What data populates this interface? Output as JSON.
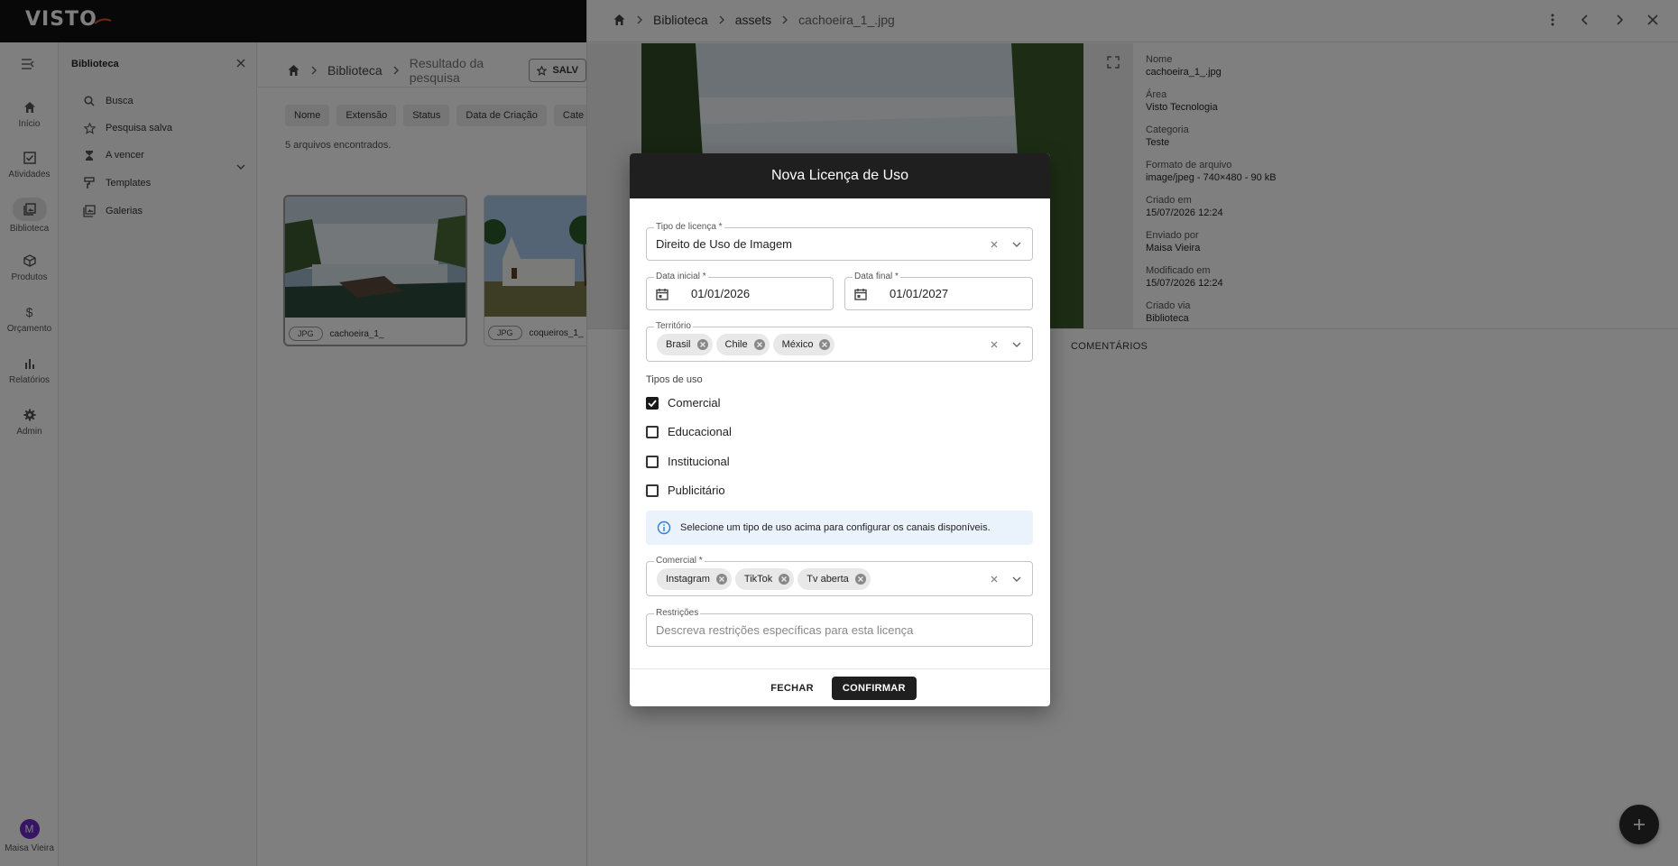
{
  "app": {
    "logo_text": "VISTO"
  },
  "rail": {
    "items": [
      {
        "label": "Início",
        "icon": "home-icon"
      },
      {
        "label": "Atividades",
        "icon": "checkbox-icon"
      },
      {
        "label": "Biblioteca",
        "icon": "library-icon"
      },
      {
        "label": "Produtos",
        "icon": "box-icon"
      },
      {
        "label": "Orçamento",
        "icon": "dollar-icon"
      },
      {
        "label": "Relatórios",
        "icon": "bar-chart-icon"
      },
      {
        "label": "Admin",
        "icon": "gear-icon"
      }
    ],
    "active": "Biblioteca",
    "user_initial": "M",
    "user_name": "Maisa Vieira"
  },
  "sidebar": {
    "title": "Biblioteca",
    "items": [
      {
        "label": "Busca",
        "icon": "search-icon"
      },
      {
        "label": "Pesquisa salva",
        "icon": "star-icon"
      },
      {
        "label": "A vencer",
        "icon": "hourglass-icon"
      },
      {
        "label": "Templates",
        "icon": "paint-roller-icon"
      },
      {
        "label": "Galerias",
        "icon": "gallery-icon"
      }
    ]
  },
  "main": {
    "breadcrumb": [
      "Biblioteca",
      "Resultado da pesquisa"
    ],
    "save_label": "SALV",
    "filters": [
      "Nome",
      "Extensão",
      "Status",
      "Data de Criação",
      "Cate"
    ],
    "result_count": "5 arquivos encontrados.",
    "cards": [
      {
        "badge": "JPG",
        "name": "cachoeira_1_"
      },
      {
        "badge": "JPG",
        "name": "coqueiros_1_"
      }
    ]
  },
  "drawer": {
    "breadcrumb": [
      "Biblioteca",
      "assets",
      "cachoeira_1_.jpg"
    ],
    "metadata": [
      {
        "label": "Nome",
        "value": "cachoeira_1_.jpg"
      },
      {
        "label": "Área",
        "value": "Visto Tecnologia"
      },
      {
        "label": "Categoria",
        "value": "Teste"
      },
      {
        "label": "Formato de arquivo",
        "value": "image/jpeg - 740×480 - 90 kB"
      },
      {
        "label": "Criado em",
        "value": "15/07/2026 12:24"
      },
      {
        "label": "Enviado por",
        "value": "Maisa Vieira"
      },
      {
        "label": "Modificado em",
        "value": "15/07/2026 12:24"
      },
      {
        "label": "Criado via",
        "value": "Biblioteca"
      }
    ],
    "tab_comments": "COMENTÁRIOS"
  },
  "dialog": {
    "title": "Nova Licença de Uso",
    "license_type": {
      "label": "Tipo de licença *",
      "value": "Direito de Uso de Imagem"
    },
    "start_date": {
      "label": "Data inicial *",
      "value": "01/01/2026"
    },
    "end_date": {
      "label": "Data final *",
      "value": "01/01/2027"
    },
    "territory": {
      "label": "Território",
      "tags": [
        "Brasil",
        "Chile",
        "México"
      ]
    },
    "usage_types_label": "Tipos de uso",
    "usage_types": [
      {
        "label": "Comercial",
        "checked": true
      },
      {
        "label": "Educacional",
        "checked": false
      },
      {
        "label": "Institucional",
        "checked": false
      },
      {
        "label": "Publicitário",
        "checked": false
      }
    ],
    "info_text": "Selecione um tipo de uso acima para configurar os canais disponíveis.",
    "channels": {
      "label": "Comercial *",
      "tags": [
        "Instagram",
        "TikTok",
        "Tv aberta"
      ]
    },
    "restrictions": {
      "label": "Restrições",
      "placeholder": "Descreva restrições específicas para esta licença"
    },
    "close_label": "FECHAR",
    "confirm_label": "CONFIRMAR"
  }
}
